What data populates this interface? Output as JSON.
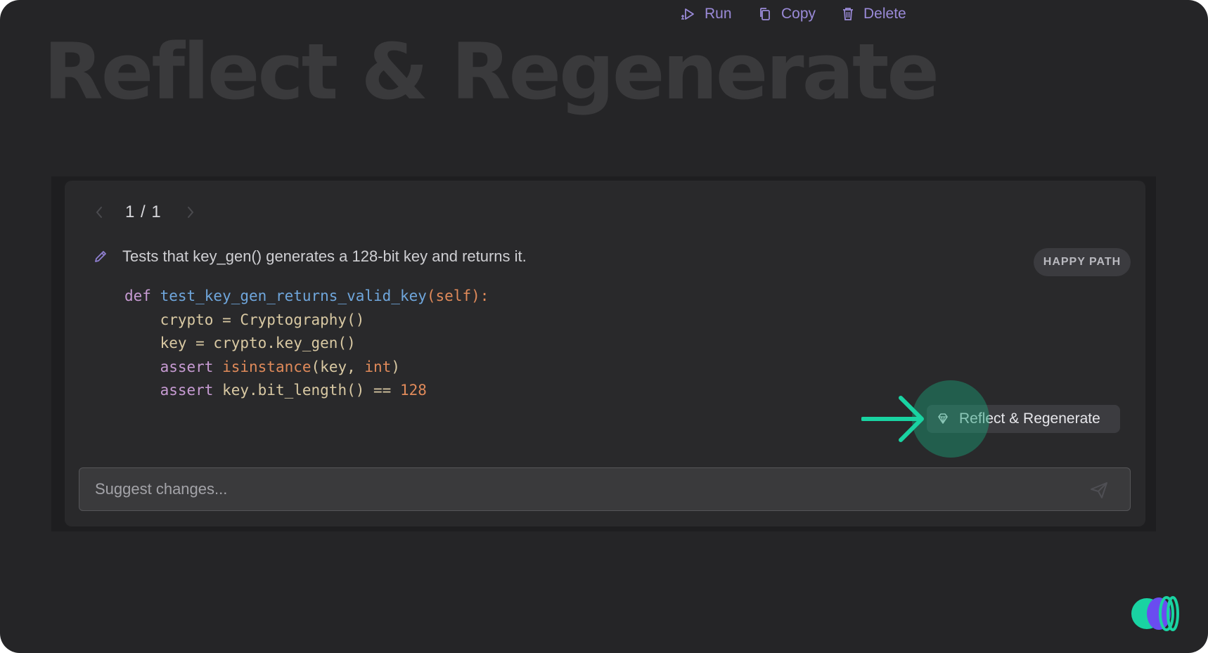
{
  "hero": {
    "title": "Reflect & Regenerate"
  },
  "pager": {
    "current": "1 / 1",
    "prev_icon": "chevron-left-icon",
    "next_icon": "chevron-right-icon"
  },
  "test": {
    "description": "Tests that key_gen() generates a 128-bit key and returns it.",
    "badge": "HAPPY PATH",
    "code_lines": [
      [
        {
          "t": "def ",
          "c": "kw"
        },
        {
          "t": "test_key_gen_returns_valid_key",
          "c": "fn"
        },
        {
          "t": "(",
          "c": "self"
        },
        {
          "t": "self",
          "c": "self"
        },
        {
          "t": "):",
          "c": "self"
        }
      ],
      [
        {
          "t": "    crypto = Cryptography()",
          "c": "plain"
        }
      ],
      [
        {
          "t": "    key = crypto.key_gen()",
          "c": "plain"
        }
      ],
      [
        {
          "t": "    ",
          "c": "plain"
        },
        {
          "t": "assert ",
          "c": "kw"
        },
        {
          "t": "isinstance",
          "c": "builtin"
        },
        {
          "t": "(key, ",
          "c": "plain"
        },
        {
          "t": "int",
          "c": "builtin"
        },
        {
          "t": ")",
          "c": "plain"
        }
      ],
      [
        {
          "t": "    ",
          "c": "plain"
        },
        {
          "t": "assert ",
          "c": "kw"
        },
        {
          "t": "key.bit_length() == ",
          "c": "plain"
        },
        {
          "t": "128",
          "c": "num"
        }
      ]
    ]
  },
  "actions": {
    "run": "Run",
    "copy": "Copy",
    "delete": "Delete",
    "regenerate": "Reflect & Regenerate"
  },
  "suggest": {
    "placeholder": "Suggest changes..."
  },
  "colors": {
    "background": "#252527",
    "panel": "#29292b",
    "action_purple": "#9a8ad8",
    "highlight_green": "#1aa078",
    "arrow_green": "#19d3a2"
  }
}
